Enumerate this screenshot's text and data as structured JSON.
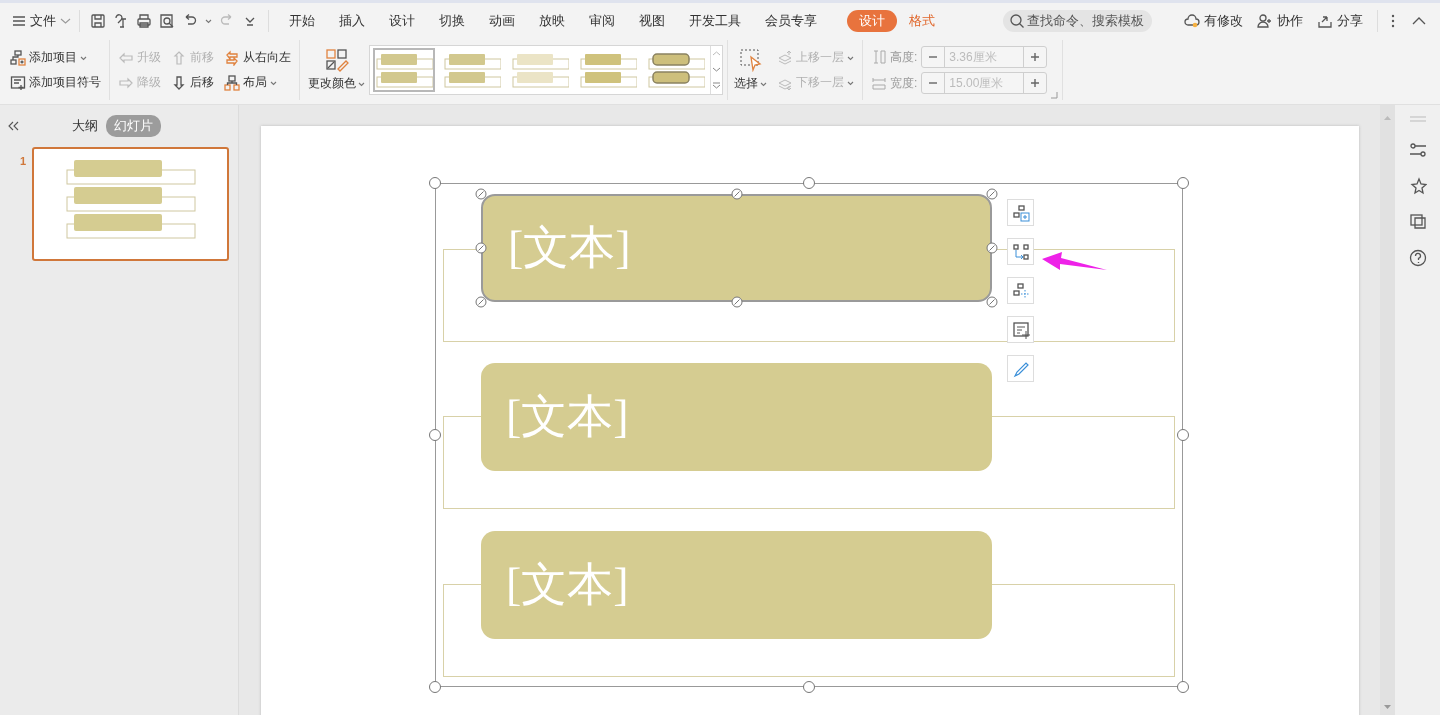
{
  "menu_bar": {
    "file_menu": "文件",
    "tabs": [
      {
        "label": "开始",
        "selected": false,
        "kind": "normal"
      },
      {
        "label": "插入",
        "selected": false,
        "kind": "normal"
      },
      {
        "label": "设计",
        "selected": false,
        "kind": "normal"
      },
      {
        "label": "切换",
        "selected": false,
        "kind": "normal"
      },
      {
        "label": "动画",
        "selected": false,
        "kind": "normal"
      },
      {
        "label": "放映",
        "selected": false,
        "kind": "normal"
      },
      {
        "label": "审阅",
        "selected": false,
        "kind": "normal"
      },
      {
        "label": "视图",
        "selected": false,
        "kind": "normal"
      },
      {
        "label": "开发工具",
        "selected": false,
        "kind": "normal"
      },
      {
        "label": "会员专享",
        "selected": false,
        "kind": "normal"
      },
      {
        "label": "设计",
        "selected": true,
        "kind": "context"
      },
      {
        "label": "格式",
        "selected": false,
        "kind": "context"
      }
    ],
    "search": {
      "placeholder": "查找命令、搜索模板"
    },
    "actions": [
      "有修改",
      "协作",
      "分享"
    ]
  },
  "ribbon": {
    "item_buttons": [
      {
        "label": "添加项目",
        "dropdown": true,
        "disabled": false
      },
      {
        "label": "添加项目符号",
        "dropdown": false,
        "disabled": false
      }
    ],
    "move_buttons": [
      {
        "label": "升级",
        "dropdown": false,
        "disabled": true
      },
      {
        "label": "前移",
        "dropdown": false,
        "disabled": true
      },
      {
        "label": "从右向左",
        "dropdown": false,
        "disabled": false
      },
      {
        "label": "降级",
        "dropdown": false,
        "disabled": true
      },
      {
        "label": "后移",
        "dropdown": false,
        "disabled": false
      },
      {
        "label": "布局",
        "dropdown": true,
        "disabled": false
      }
    ],
    "change_color": {
      "label": "更改颜色",
      "dropdown": true
    },
    "styles": [
      {
        "kind": "flat",
        "selected": true
      },
      {
        "kind": "flat",
        "selected": false
      },
      {
        "kind": "light",
        "selected": false
      },
      {
        "kind": "gradient",
        "selected": false
      },
      {
        "kind": "shadow",
        "selected": false
      }
    ],
    "select": {
      "label": "选择",
      "dropdown": true
    },
    "layer_buttons": [
      {
        "label": "上移一层",
        "dropdown": true,
        "disabled": true
      },
      {
        "label": "下移一层",
        "dropdown": true,
        "disabled": true
      }
    ],
    "size": [
      {
        "label": "高度:",
        "value": "3.36厘米",
        "disabled": true
      },
      {
        "label": "宽度:",
        "value": "15.00厘米",
        "disabled": true
      }
    ]
  },
  "side_panel": {
    "tabs": [
      {
        "label": "大纲",
        "selected": false
      },
      {
        "label": "幻灯片",
        "selected": true
      }
    ],
    "slides": [
      {
        "number": "1",
        "selected": true
      }
    ]
  },
  "slide": {
    "items": [
      {
        "text": "[文本]",
        "selected": true
      },
      {
        "text": "[文本]",
        "selected": false
      },
      {
        "text": "[文本]",
        "selected": false
      }
    ]
  }
}
